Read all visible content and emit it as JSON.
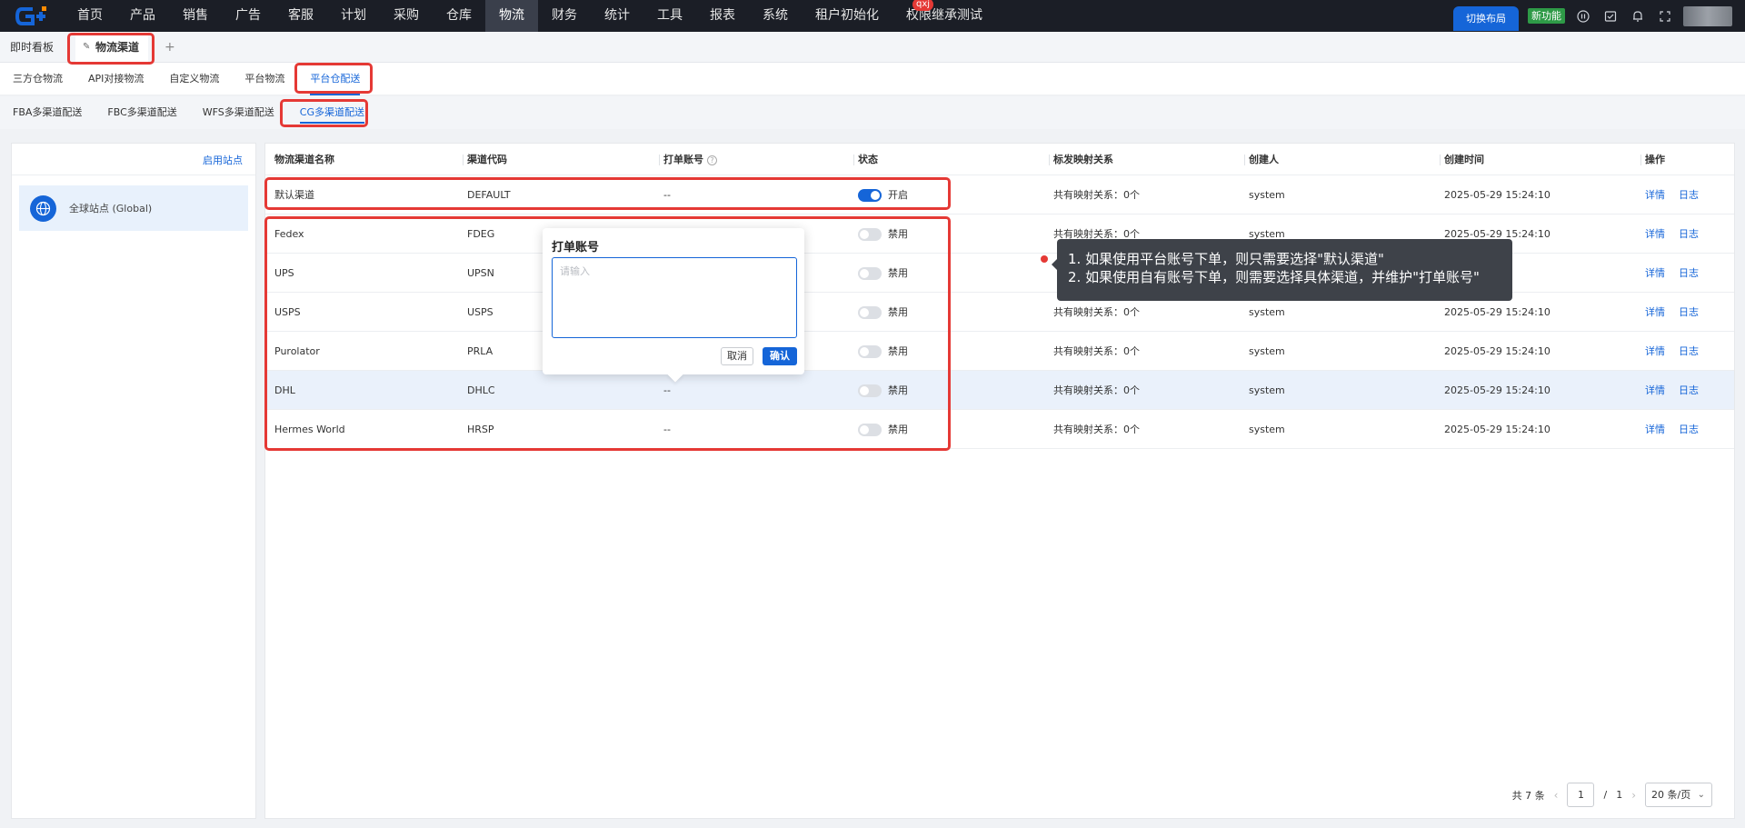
{
  "topnav": {
    "items": [
      "首页",
      "产品",
      "销售",
      "广告",
      "客服",
      "计划",
      "采购",
      "仓库",
      "物流",
      "财务",
      "统计",
      "工具",
      "报表",
      "系统",
      "租户初始化",
      "权限继承测试"
    ],
    "active_index": 8,
    "badge_text": "qxj",
    "switch_layout": "切换布局",
    "new_feature": "新功能"
  },
  "tabs": {
    "home": "即时看板",
    "active": "物流渠道",
    "add": "+"
  },
  "subtabs1": [
    "三方仓物流",
    "API对接物流",
    "自定义物流",
    "平台物流",
    "平台仓配送"
  ],
  "subtabs1_active": 4,
  "subtabs2": [
    "FBA多渠道配送",
    "FBC多渠道配送",
    "WFS多渠道配送",
    "CG多渠道配送"
  ],
  "subtabs2_active": 3,
  "left": {
    "enable_site": "启用站点",
    "site_label": "全球站点 (Global)"
  },
  "table": {
    "columns": [
      "物流渠道名称",
      "渠道代码",
      "打单账号",
      "状态",
      "标发映射关系",
      "创建人",
      "创建时间",
      "操作"
    ],
    "rows": [
      {
        "name": "默认渠道",
        "code": "DEFAULT",
        "account": "--",
        "on": true,
        "status": "开启",
        "mapping": "共有映射关系：0个",
        "creator": "system",
        "time": "2025-05-29 15:24:10",
        "detail": "详情",
        "log": "日志"
      },
      {
        "name": "Fedex",
        "code": "FDEG",
        "account": "",
        "on": false,
        "status": "禁用",
        "mapping": "共有映射关系：0个",
        "creator": "system",
        "time": "2025-05-29 15:24:10",
        "detail": "详情",
        "log": "日志"
      },
      {
        "name": "UPS",
        "code": "UPSN",
        "account": "",
        "on": false,
        "status": "禁用",
        "mapping": "",
        "creator": "",
        "time": "",
        "detail": "详情",
        "log": "日志"
      },
      {
        "name": "USPS",
        "code": "USPS",
        "account": "",
        "on": false,
        "status": "禁用",
        "mapping": "共有映射关系：0个",
        "creator": "system",
        "time": "2025-05-29 15:24:10",
        "detail": "详情",
        "log": "日志"
      },
      {
        "name": "Purolator",
        "code": "PRLA",
        "account": "",
        "on": false,
        "status": "禁用",
        "mapping": "共有映射关系：0个",
        "creator": "system",
        "time": "2025-05-29 15:24:10",
        "detail": "详情",
        "log": "日志"
      },
      {
        "name": "DHL",
        "code": "DHLC",
        "account": "--",
        "on": false,
        "status": "禁用",
        "mapping": "共有映射关系：0个",
        "creator": "system",
        "time": "2025-05-29 15:24:10",
        "detail": "详情",
        "log": "日志"
      },
      {
        "name": "Hermes World",
        "code": "HRSP",
        "account": "--",
        "on": false,
        "status": "禁用",
        "mapping": "共有映射关系：0个",
        "creator": "system",
        "time": "2025-05-29 15:24:10",
        "detail": "详情",
        "log": "日志"
      }
    ],
    "highlight_row": 5
  },
  "popover": {
    "title": "打单账号",
    "placeholder": "请输入",
    "cancel": "取消",
    "confirm": "确认"
  },
  "tooltip": {
    "line1": "1. 如果使用平台账号下单，则只需要选择\"默认渠道\"",
    "line2": "2. 如果使用自有账号下单，则需要选择具体渠道，并维护\"打单账号\""
  },
  "pagination": {
    "total": "共 7 条",
    "current": "1",
    "sep": "/",
    "pages": "1",
    "page_size": "20 条/页"
  },
  "colors": {
    "accent": "#1565d8",
    "highlight": "#e53935",
    "nav_bg": "#1b1e26"
  }
}
